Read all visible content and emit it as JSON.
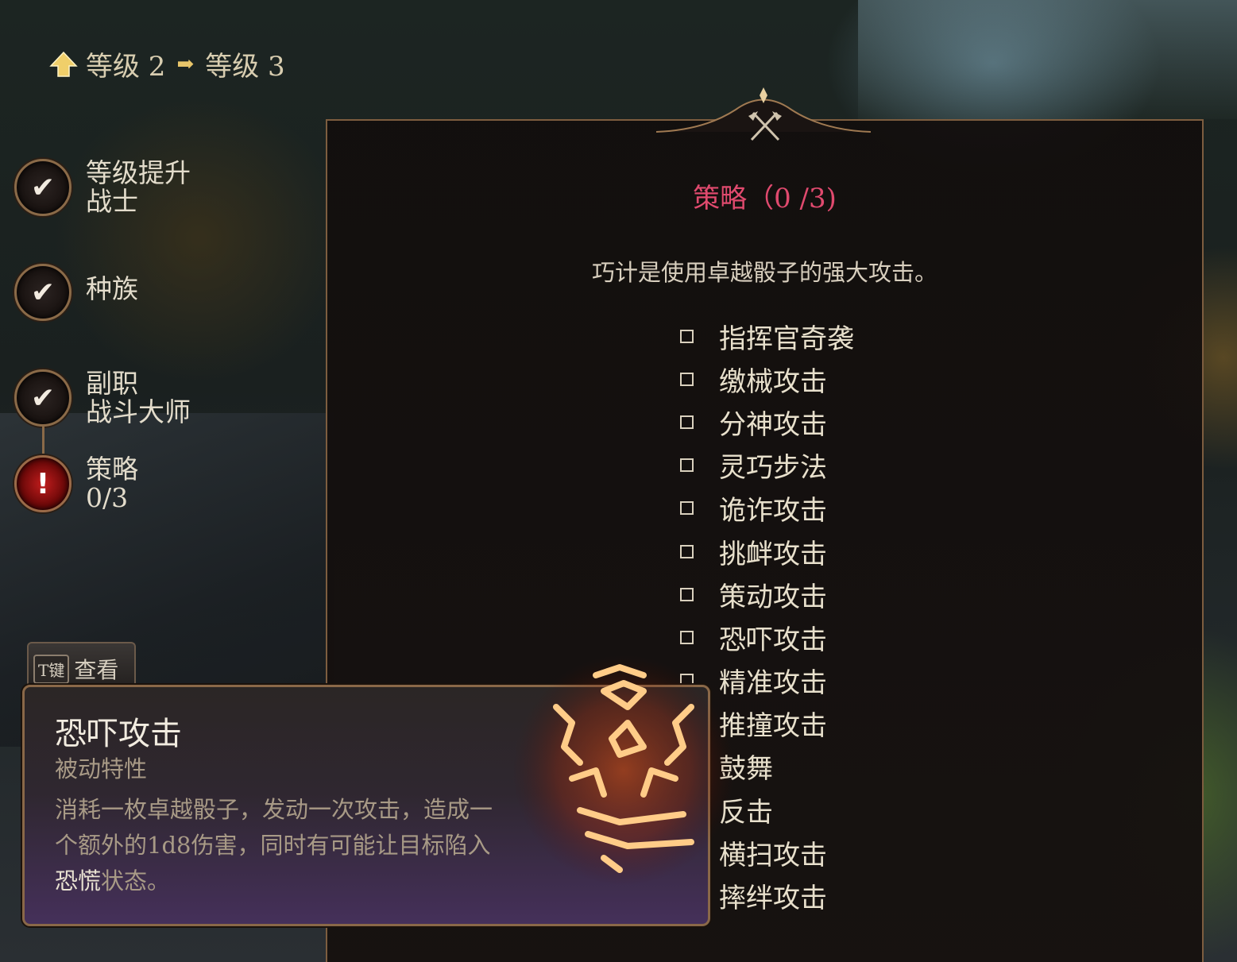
{
  "header": {
    "from_level": "等级 2",
    "to_level": "等级 3"
  },
  "sidebar": {
    "steps": [
      {
        "line1": "等级提升",
        "line2": "战士",
        "status": "complete"
      },
      {
        "line1": "种族",
        "line2": "",
        "status": "complete"
      },
      {
        "line1": "副职",
        "line2": "战斗大师",
        "status": "complete"
      },
      {
        "line1": "策略",
        "line2": "0/3",
        "status": "alert"
      }
    ],
    "alert_symbol": "!"
  },
  "panel": {
    "title": "策略（0 /3)",
    "description": "巧计是使用卓越骰子的强大攻击。",
    "options": [
      "指挥官奇袭",
      "缴械攻击",
      "分神攻击",
      "灵巧步法",
      "诡诈攻击",
      "挑衅攻击",
      "策动攻击",
      "恐吓攻击",
      "精准攻击",
      "推撞攻击",
      "鼓舞",
      "反击",
      "横扫攻击",
      "摔绊攻击"
    ]
  },
  "examine_tab": {
    "key": "T键",
    "label": "查看"
  },
  "tooltip": {
    "title": "恐吓攻击",
    "subtitle": "被动特性",
    "desc_before": "消耗一枚卓越骰子，发动一次攻击，造成一个额外的1d8伤害，同时有可能让目标陷入",
    "desc_highlight": "恐慌",
    "desc_after": "状态。"
  },
  "colors": {
    "title_accent": "#e04a6e",
    "frame_gold": "#8a6a48",
    "alert_red": "#c21d1d"
  },
  "icons": [
    "up-arrow-icon",
    "arrow-right-icon",
    "checkmark-icon",
    "axe-crest-icon",
    "rune-icon"
  ]
}
